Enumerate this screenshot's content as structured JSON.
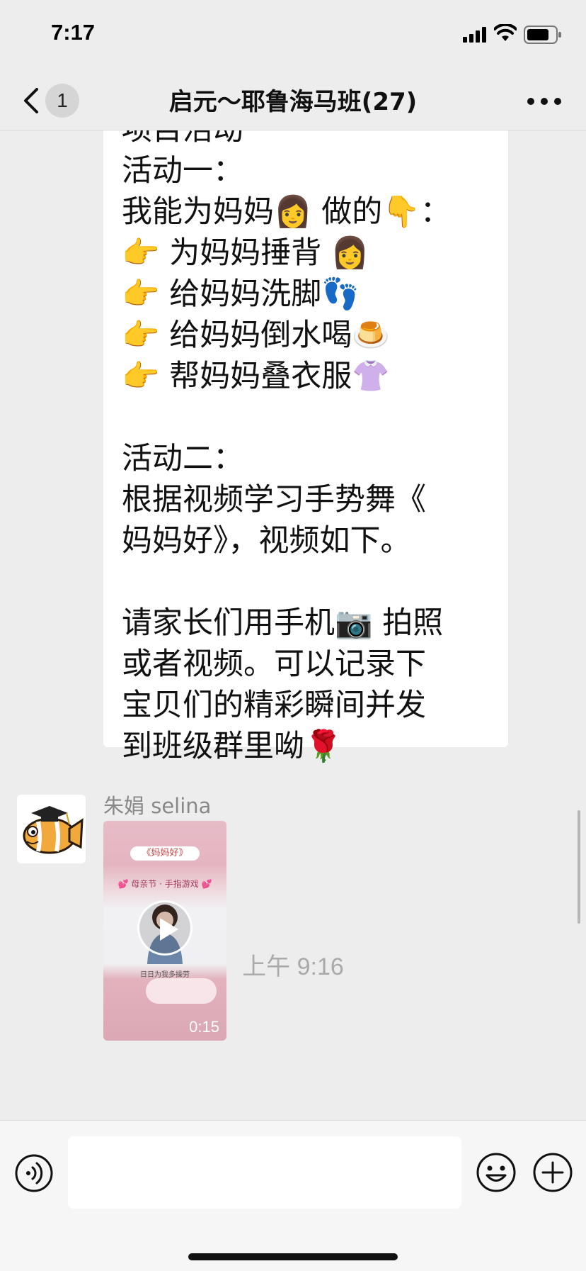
{
  "status_bar": {
    "time": "7:17"
  },
  "nav": {
    "back_badge": "1",
    "title": "启元～耶鲁海马班(27)"
  },
  "message": {
    "text": "项目活动\n活动一：\n我能为妈妈👩 做的👇：\n👉 为妈妈捶背 👩\n👉 给妈妈洗脚👣\n👉 给妈妈倒水喝🍮\n👉 帮妈妈叠衣服👚\n\n活动二：\n根据视频学习手势舞《\n妈妈好》，视频如下。\n\n请家长们用手机📷 拍照\n或者视频。可以记录下\n宝贝们的精彩瞬间并发\n到班级群里呦🌹"
  },
  "video_message": {
    "sender": "朱娟 selina",
    "video_title": "《妈妈好》",
    "video_subtitle": "💕 母亲节 · 手指游戏 💕",
    "video_caption": "日日为我多操劳",
    "duration": "0:15"
  },
  "timestamp": "上午 9:16",
  "colors": {
    "background": "#ededed",
    "bubble": "#ffffff",
    "timestamp": "#aaaaaa",
    "sender": "#888888"
  },
  "icons": {
    "back": "chevron-left-icon",
    "more": "more-dots-icon",
    "voice": "voice-icon",
    "emoji": "emoji-icon",
    "plus": "plus-icon",
    "play": "play-icon"
  }
}
